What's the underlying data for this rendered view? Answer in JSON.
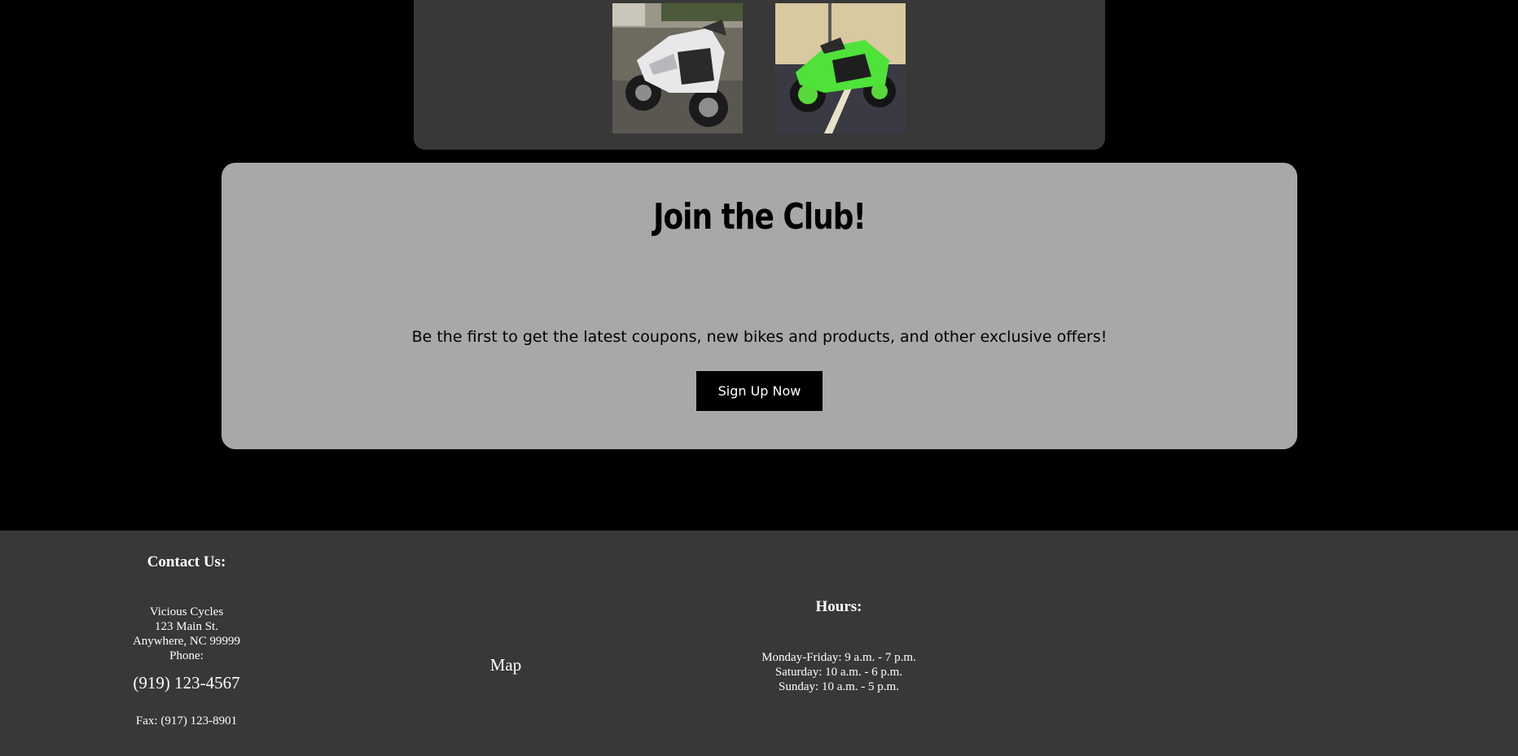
{
  "gallery": {
    "images": [
      {
        "alt": "white sport motorcycle"
      },
      {
        "alt": "green sport motorcycle"
      }
    ]
  },
  "club": {
    "title": "Join the Club!",
    "description": "Be the first to get the latest coupons, new bikes and products, and other exclusive offers!",
    "button_label": "Sign Up Now"
  },
  "footer": {
    "contact": {
      "heading": "Contact Us:",
      "name": "Vicious Cycles",
      "street": "123 Main St.",
      "city": "Anywhere, NC 99999",
      "phone_label": "Phone:",
      "phone": "(919) 123-4567",
      "fax": "Fax: (917) 123-8901"
    },
    "map_label": "Map",
    "hours": {
      "heading": "Hours:",
      "weekday": "Monday-Friday: 9 a.m. - 7 p.m.",
      "saturday": "Saturday: 10 a.m. - 6 p.m.",
      "sunday": "Sunday: 10 a.m. - 5 p.m."
    }
  },
  "colors": {
    "page_background": "#000000",
    "panel_dark": "#383838",
    "panel_light": "#a8a8a8",
    "button_background": "#000000",
    "button_text": "#ffffff"
  }
}
